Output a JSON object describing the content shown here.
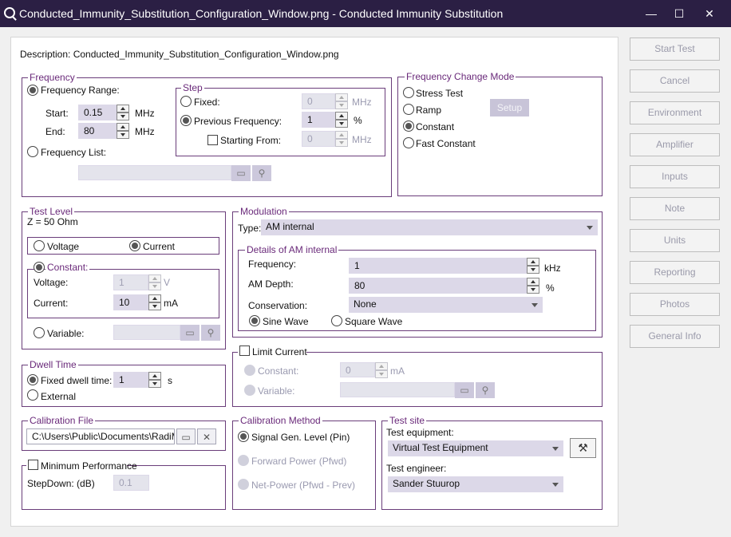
{
  "window": {
    "title": "Conducted_Immunity_Substitution_Configuration_Window.png - Conducted Immunity Substitution",
    "minimize": "—",
    "maximize": "☐",
    "close": "✕"
  },
  "description": "Description: Conducted_Immunity_Substitution_Configuration_Window.png",
  "frequency": {
    "title": "Frequency",
    "range_label": "Frequency Range:",
    "start_label": "Start:",
    "start_value": "0.15",
    "start_unit": "MHz",
    "end_label": "End:",
    "end_value": "80",
    "end_unit": "MHz",
    "list_label": "Frequency List:"
  },
  "step": {
    "title": "Step",
    "fixed_label": "Fixed:",
    "fixed_value": "0",
    "fixed_unit": "MHz",
    "prev_label": "Previous Frequency:",
    "prev_value": "1",
    "prev_unit": "%",
    "starting_label": "Starting From:",
    "starting_value": "0",
    "starting_unit": "MHz"
  },
  "change_mode": {
    "title": "Frequency Change Mode",
    "options": [
      "Stress Test",
      "Ramp",
      "Constant",
      "Fast Constant"
    ],
    "selected": "Constant",
    "setup": "Setup"
  },
  "test_level": {
    "title": "Test Level",
    "impedance": "Z = 50 Ohm",
    "voltage": "Voltage",
    "current": "Current",
    "constant": "Constant:",
    "voltage_label": "Voltage:",
    "voltage_value": "1",
    "voltage_unit": "V",
    "current_label": "Current:",
    "current_value": "10",
    "current_unit": "mA",
    "variable": "Variable:"
  },
  "modulation": {
    "title": "Modulation",
    "type_label": "Type:",
    "type_value": "AM internal",
    "details_title": "Details of AM internal",
    "freq_label": "Frequency:",
    "freq_value": "1",
    "freq_unit": "kHz",
    "depth_label": "AM Depth:",
    "depth_value": "80",
    "depth_unit": "%",
    "cons_label": "Conservation:",
    "cons_value": "None",
    "sine": "Sine Wave",
    "square": "Square Wave"
  },
  "dwell": {
    "title": "Dwell Time",
    "fixed_label": "Fixed dwell time:",
    "fixed_value": "1",
    "fixed_unit": "s",
    "external": "External"
  },
  "limit": {
    "title": "Limit Current",
    "constant": "Constant:",
    "constant_value": "0",
    "constant_unit": "mA",
    "variable": "Variable:"
  },
  "calibration_file": {
    "title": "Calibration File",
    "path": "C:\\Users\\Public\\Documents\\RadiMatic"
  },
  "min_perf": {
    "title": "Minimum Performance",
    "stepdown_label": "StepDown: (dB)",
    "stepdown_value": "0.1"
  },
  "cal_method": {
    "title": "Calibration Method",
    "options": [
      "Signal Gen. Level (Pin)",
      "Forward Power (Pfwd)",
      "Net-Power (Pfwd - Prev)"
    ]
  },
  "test_site": {
    "title": "Test site",
    "equipment_label": "Test equipment:",
    "equipment_value": "Virtual Test Equipment",
    "engineer_label": "Test engineer:",
    "engineer_value": "Sander Stuurop"
  },
  "sidebar": [
    "Start Test",
    "Cancel",
    "Environment",
    "Amplifier",
    "Inputs",
    "Note",
    "Units",
    "Reporting",
    "Photos",
    "General Info"
  ]
}
